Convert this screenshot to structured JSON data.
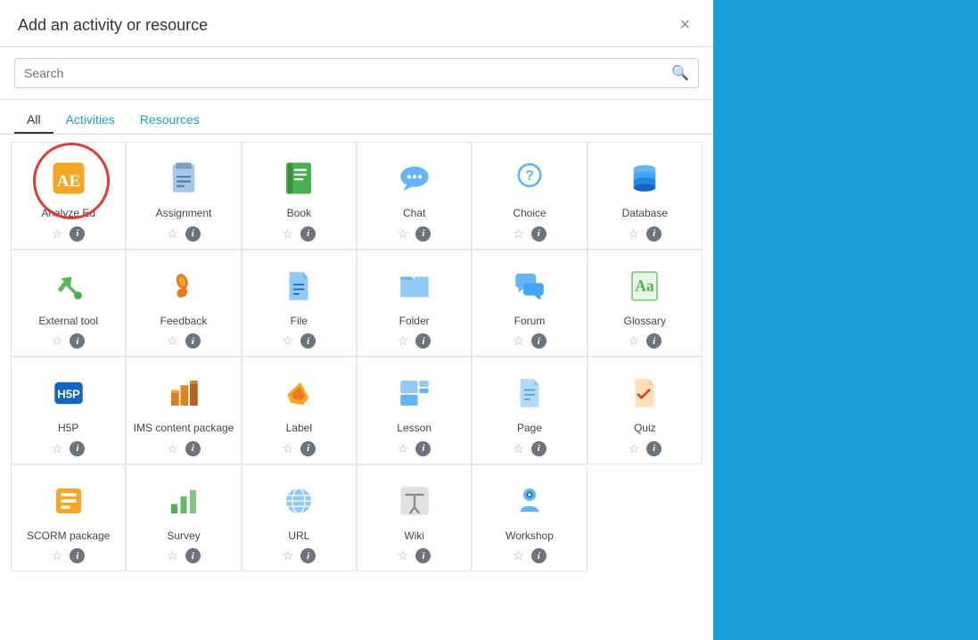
{
  "modal": {
    "title": "Add an activity or resource",
    "close_label": "×",
    "search_placeholder": "Search"
  },
  "tabs": [
    {
      "id": "all",
      "label": "All",
      "active": true
    },
    {
      "id": "activities",
      "label": "Activities",
      "active": false
    },
    {
      "id": "resources",
      "label": "Resources",
      "active": false
    }
  ],
  "items": [
    {
      "id": "analyze-ed",
      "label": "Analyze Ed",
      "icon": "analyze-ed-icon",
      "highlighted": true
    },
    {
      "id": "assignment",
      "label": "Assignment",
      "icon": "assignment-icon",
      "highlighted": false
    },
    {
      "id": "book",
      "label": "Book",
      "icon": "book-icon",
      "highlighted": false
    },
    {
      "id": "chat",
      "label": "Chat",
      "icon": "chat-icon",
      "highlighted": false
    },
    {
      "id": "choice",
      "label": "Choice",
      "icon": "choice-icon",
      "highlighted": false
    },
    {
      "id": "database",
      "label": "Database",
      "icon": "database-icon",
      "highlighted": false
    },
    {
      "id": "external-tool",
      "label": "External tool",
      "icon": "external-tool-icon",
      "highlighted": false
    },
    {
      "id": "feedback",
      "label": "Feedback",
      "icon": "feedback-icon",
      "highlighted": false
    },
    {
      "id": "file",
      "label": "File",
      "icon": "file-icon",
      "highlighted": false
    },
    {
      "id": "folder",
      "label": "Folder",
      "icon": "folder-icon",
      "highlighted": false
    },
    {
      "id": "forum",
      "label": "Forum",
      "icon": "forum-icon",
      "highlighted": false
    },
    {
      "id": "glossary",
      "label": "Glossary",
      "icon": "glossary-icon",
      "highlighted": false
    },
    {
      "id": "h5p",
      "label": "H5P",
      "icon": "h5p-icon",
      "highlighted": false
    },
    {
      "id": "ims-content",
      "label": "IMS content package",
      "icon": "ims-icon",
      "highlighted": false
    },
    {
      "id": "label",
      "label": "Label",
      "icon": "label-icon",
      "highlighted": false
    },
    {
      "id": "lesson",
      "label": "Lesson",
      "icon": "lesson-icon",
      "highlighted": false
    },
    {
      "id": "page",
      "label": "Page",
      "icon": "page-icon",
      "highlighted": false
    },
    {
      "id": "quiz",
      "label": "Quiz",
      "icon": "quiz-icon",
      "highlighted": false
    },
    {
      "id": "scorm",
      "label": "SCORM package",
      "icon": "scorm-icon",
      "highlighted": false
    },
    {
      "id": "survey",
      "label": "Survey",
      "icon": "survey-icon",
      "highlighted": false
    },
    {
      "id": "url",
      "label": "URL",
      "icon": "url-icon",
      "highlighted": false
    },
    {
      "id": "wiki",
      "label": "Wiki",
      "icon": "wiki-icon",
      "highlighted": false
    },
    {
      "id": "workshop",
      "label": "Workshop",
      "icon": "workshop-icon",
      "highlighted": false
    }
  ]
}
